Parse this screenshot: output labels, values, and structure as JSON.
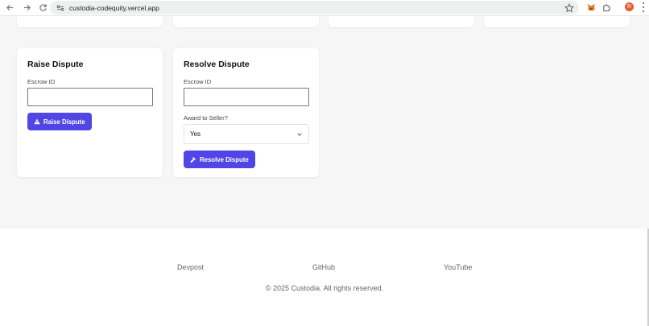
{
  "browser": {
    "url": "custodia-codequity.vercel.app",
    "avatar_letter": "R"
  },
  "raise_card": {
    "title": "Raise Dispute",
    "escrow_label": "Escrow ID",
    "escrow_value": "",
    "button_label": "Raise Dispute"
  },
  "resolve_card": {
    "title": "Resolve Dispute",
    "escrow_label": "Escrow ID",
    "escrow_value": "",
    "award_label": "Award to Seller?",
    "award_selected": "Yes",
    "button_label": "Resolve Dispute"
  },
  "footer": {
    "links": [
      "Devpost",
      "GitHub",
      "YouTube"
    ],
    "copyright": "© 2025 Custodia. All rights reserved."
  },
  "colors": {
    "accent": "#4f46e5",
    "page_bg": "#f6f6f6",
    "avatar": "#e4592e"
  }
}
